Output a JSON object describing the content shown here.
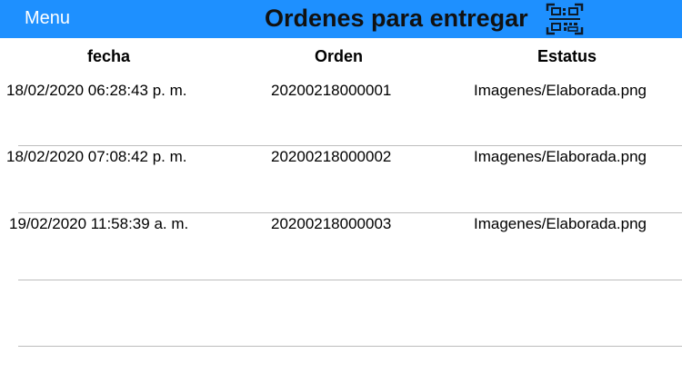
{
  "nav": {
    "menu_label": "Menu",
    "title": "Ordenes para entregar",
    "scan_icon": "qr-scan-icon",
    "background": "#1e90ff"
  },
  "columns": {
    "fecha": "fecha",
    "orden": "Orden",
    "estatus": "Estatus"
  },
  "rows": [
    {
      "fecha": "18/02/2020 06:28:43 p. m.",
      "orden": "20200218000001",
      "estatus": "Imagenes/Elaborada.png"
    },
    {
      "fecha": "18/02/2020 07:08:42 p. m.",
      "orden": "20200218000002",
      "estatus": "Imagenes/Elaborada.png"
    },
    {
      "fecha": "19/02/2020 11:58:39 a. m.",
      "orden": "20200218000003",
      "estatus": "Imagenes/Elaborada.png"
    }
  ]
}
